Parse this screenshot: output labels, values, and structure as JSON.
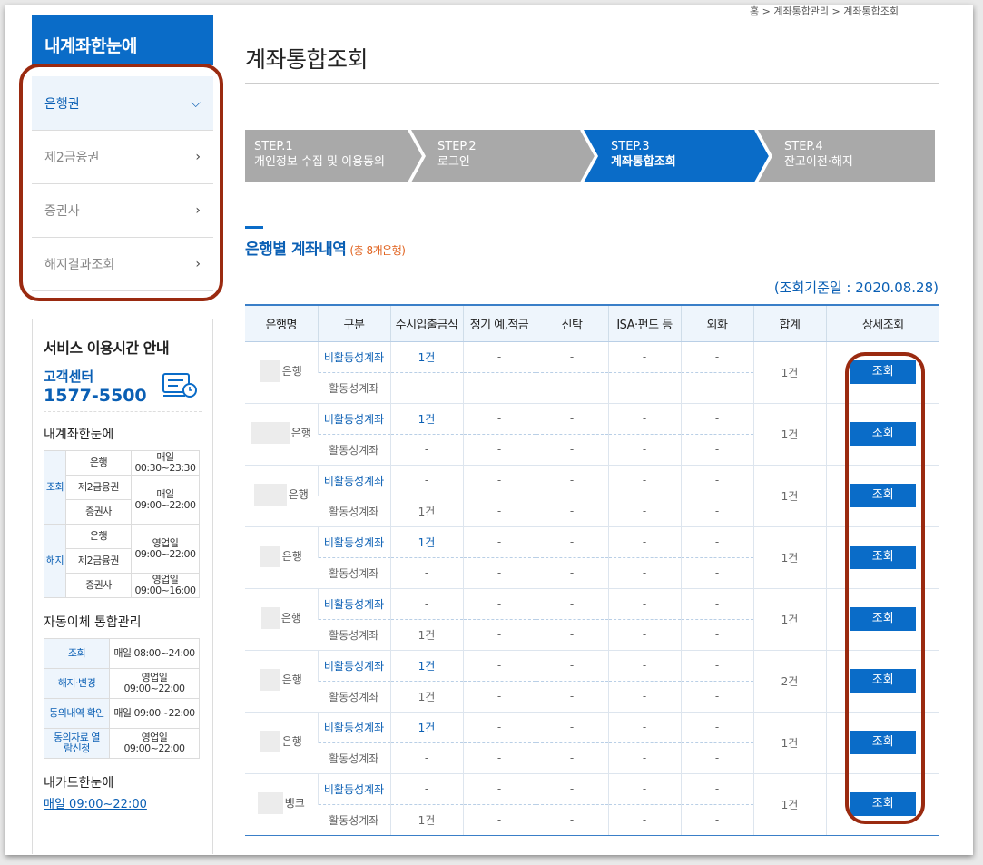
{
  "sidebar": {
    "title": "내계좌한눈에",
    "menu": [
      {
        "label": "은행권",
        "active": true
      },
      {
        "label": "제2금융권",
        "active": false
      },
      {
        "label": "증권사",
        "active": false
      },
      {
        "label": "해지결과조회",
        "active": false
      }
    ],
    "service": {
      "heading": "서비스 이용시간 안내",
      "cc_label": "고객센터",
      "cc_number": "1577-5500",
      "section1": "내계좌한눈에",
      "t1": {
        "inquiry": "조회",
        "cancel": "해지",
        "bank": "은행",
        "second": "제2금융권",
        "sec": "증권사",
        "daily": "매일",
        "bank_time": "00:30~23:30",
        "other_time": "09:00~22:00",
        "bizday": "영업일",
        "cancel_time1": "09:00~22:00",
        "cancel_time2": "09:00~16:00"
      },
      "section2": "자동이체 통합관리",
      "t2": [
        {
          "label": "조회",
          "value": "매일 08:00~24:00"
        },
        {
          "label": "해지·변경",
          "value": "영업일 09:00~22:00"
        },
        {
          "label": "동의내역 확인",
          "value": "매일 09:00~22:00"
        },
        {
          "label": "동의자료 열람신청",
          "value": "영업일 09:00~22:00"
        }
      ],
      "card_title": "내카드한눈에",
      "card_time": "매일 09:00~22:00"
    }
  },
  "breadcrumb": "홈 > 계좌통합관리 > 계좌통합조회",
  "page_title": "계좌통합조회",
  "steps": [
    {
      "num": "STEP.1",
      "label": "개인정보 수집 및 이용동의",
      "active": false
    },
    {
      "num": "STEP.2",
      "label": "로그인",
      "active": false
    },
    {
      "num": "STEP.3",
      "label": "계좌통합조회",
      "active": true
    },
    {
      "num": "STEP.4",
      "label": "잔고이전·해지",
      "active": false
    }
  ],
  "section": {
    "title": "은행별 계좌내역",
    "count": "(총 8개은행)"
  },
  "base_date": "(조회기준일 : 2020.08.28)",
  "table": {
    "headers": [
      "은행명",
      "구분",
      "수시입출금식",
      "정기 예,적금",
      "신탁",
      "ISA·펀드 등",
      "외화",
      "합계",
      "상세조회"
    ],
    "type_inactive": "비활동성계좌",
    "type_active": "활동성계좌",
    "button": "조회",
    "rows": [
      {
        "bank": "은행",
        "inactive": [
          "1건",
          "-",
          "-",
          "-",
          "-"
        ],
        "active": [
          "-",
          "-",
          "-",
          "-",
          "-"
        ],
        "total": "1건"
      },
      {
        "bank": "은행",
        "inactive": [
          "1건",
          "-",
          "-",
          "-",
          "-"
        ],
        "active": [
          "-",
          "-",
          "-",
          "-",
          "-"
        ],
        "total": "1건"
      },
      {
        "bank": "은행",
        "inactive": [
          "-",
          "-",
          "-",
          "-",
          "-"
        ],
        "active": [
          "1건",
          "-",
          "-",
          "-",
          "-"
        ],
        "total": "1건"
      },
      {
        "bank": "은행",
        "inactive": [
          "1건",
          "-",
          "-",
          "-",
          "-"
        ],
        "active": [
          "-",
          "-",
          "-",
          "-",
          "-"
        ],
        "total": "1건"
      },
      {
        "bank": "은행",
        "inactive": [
          "-",
          "-",
          "-",
          "-",
          "-"
        ],
        "active": [
          "1건",
          "-",
          "-",
          "-",
          "-"
        ],
        "total": "1건"
      },
      {
        "bank": "은행",
        "inactive": [
          "1건",
          "-",
          "-",
          "-",
          "-"
        ],
        "active": [
          "1건",
          "-",
          "-",
          "-",
          "-"
        ],
        "total": "2건"
      },
      {
        "bank": "은행",
        "inactive": [
          "1건",
          "-",
          "-",
          "-",
          "-"
        ],
        "active": [
          "-",
          "-",
          "-",
          "-",
          "-"
        ],
        "total": "1건"
      },
      {
        "bank": "뱅크",
        "inactive": [
          "-",
          "-",
          "-",
          "-",
          "-"
        ],
        "active": [
          "1건",
          "-",
          "-",
          "-",
          "-"
        ],
        "total": "1건"
      }
    ]
  },
  "colors": {
    "accent": "#0a6cc8",
    "step_inactive": "#a9a9a9",
    "highlight_outline": "#9a2a10",
    "count_orange": "#e0621e"
  }
}
